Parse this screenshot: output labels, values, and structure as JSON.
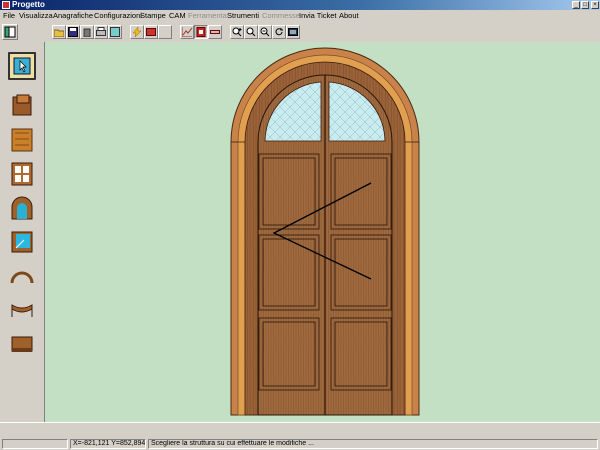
{
  "window": {
    "title": "Progetto"
  },
  "menu": {
    "items": [
      {
        "label": "File",
        "enabled": true
      },
      {
        "label": "Visualizza",
        "enabled": true
      },
      {
        "label": "Anagrafiche",
        "enabled": true
      },
      {
        "label": "Configurazioni",
        "enabled": true
      },
      {
        "label": "Stampe",
        "enabled": true
      },
      {
        "label": "CAM",
        "enabled": true
      },
      {
        "label": "Ferramenta",
        "enabled": false
      },
      {
        "label": "Strumenti",
        "enabled": true
      },
      {
        "label": "Commesse",
        "enabled": false
      },
      {
        "label": "Invia Ticket",
        "enabled": true
      },
      {
        "label": "About",
        "enabled": true
      }
    ]
  },
  "toolbar": {
    "buttons": [
      {
        "icon": "open-folder-icon"
      },
      {
        "icon": "save-icon"
      },
      {
        "icon": "delete-icon"
      },
      {
        "icon": "print-icon"
      },
      {
        "icon": "preview-icon"
      },
      {
        "icon": "lightning-icon"
      },
      {
        "icon": "calculate-icon"
      },
      {
        "icon": "blank-icon"
      },
      {
        "icon": "chart-icon"
      },
      {
        "icon": "select-element-icon",
        "pressed": true
      },
      {
        "icon": "ruler-icon"
      },
      {
        "icon": "zoom-in-plus-icon"
      },
      {
        "icon": "zoom-area-icon"
      },
      {
        "icon": "zoom-out-icon"
      },
      {
        "icon": "rotate-icon"
      },
      {
        "icon": "screen-icon"
      }
    ]
  },
  "left_tools": [
    {
      "icon": "select-pointer-icon"
    },
    {
      "icon": "profile-block-icon"
    },
    {
      "icon": "wood-panel-icon"
    },
    {
      "icon": "frame-window-icon"
    },
    {
      "icon": "arched-frame-icon"
    },
    {
      "icon": "glass-corner-icon"
    },
    {
      "icon": "arch-curve-icon"
    },
    {
      "icon": "bottom-arch-icon"
    },
    {
      "icon": "threshold-icon"
    }
  ],
  "colors": {
    "canvas": "#c4e0c4",
    "wood_dark": "#8b5a2b",
    "wood_light": "#b9784a",
    "glass": "#c8ecf0"
  },
  "status": {
    "coords": "X=-821,121 Y=852,894",
    "message": "Scegliere la struttura su cui effettuare le modifiche ..."
  }
}
